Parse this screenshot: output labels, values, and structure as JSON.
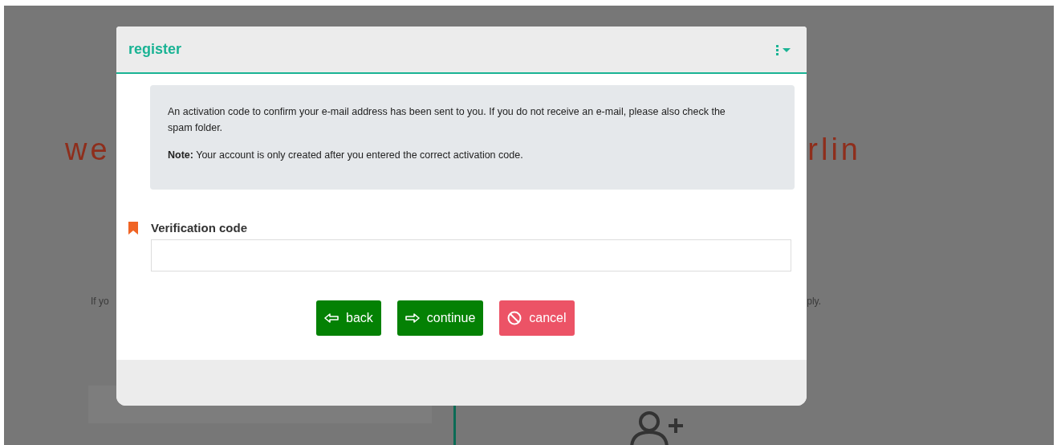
{
  "background": {
    "heading_left": "we",
    "heading_right": "rlin",
    "text_left": "If yo",
    "text_right": "ply."
  },
  "dialog": {
    "title": "register",
    "message": "An activation code to confirm your e-mail address has been sent to you. If you do not receive an e-mail, please also check the spam folder.",
    "note": "**Note:** Your account is only created after you entered the correct activation code.",
    "field": {
      "label": "Verification code",
      "required": true
    },
    "buttons": [
      {
        "label": "back",
        "kind": "back"
      },
      {
        "label": "continue",
        "kind": "continue"
      },
      {
        "label": "cancel",
        "kind": "cancel"
      }
    ]
  }
}
